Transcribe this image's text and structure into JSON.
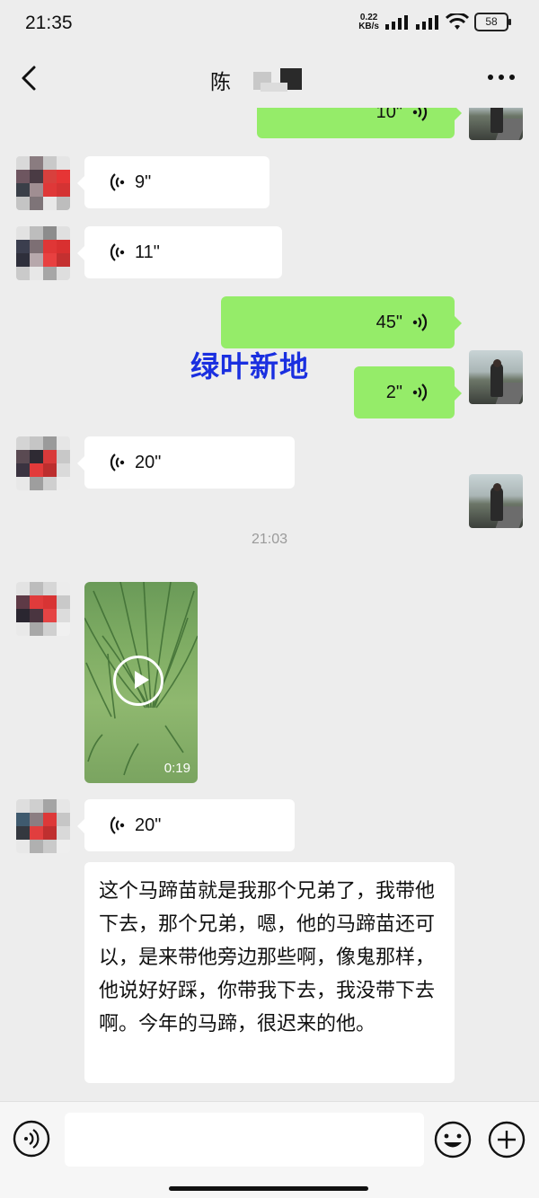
{
  "status": {
    "time": "21:35",
    "net_speed": "0.22",
    "net_unit": "KB/s",
    "battery": "58"
  },
  "nav": {
    "title": "陈",
    "back_icon": "chevron-left-icon",
    "more_icon": "more-dots-icon"
  },
  "messages": [
    {
      "side": "out",
      "type": "voice",
      "duration": "10\""
    },
    {
      "side": "in",
      "type": "voice",
      "duration": "9\""
    },
    {
      "side": "in",
      "type": "voice",
      "duration": "11\""
    },
    {
      "side": "out",
      "type": "voice",
      "duration": "45\""
    },
    {
      "side": "out",
      "type": "voice",
      "duration": "2\""
    },
    {
      "side": "in",
      "type": "voice",
      "duration": "20\""
    },
    {
      "type": "timestamp",
      "text": "21:03"
    },
    {
      "side": "in",
      "type": "video",
      "duration": "0:19"
    },
    {
      "side": "in",
      "type": "voice",
      "duration": "20\""
    },
    {
      "side": "in",
      "type": "text",
      "text": "这个马蹄苗就是我那个兄弟了，我带他下去，那个兄弟，嗯，他的马蹄苗还可以，是来带他旁边那些啊，像鬼那样，他说好好踩，你带我下去，我没带下去啊。今年的马蹄，很迟来的他。"
    }
  ],
  "watermark": "绿叶新地",
  "colors": {
    "background": "#ededed",
    "outgoing_bubble": "#95ec69",
    "incoming_bubble": "#ffffff",
    "watermark": "#1a2fe0"
  },
  "inputbar": {
    "voice_icon": "voice-input-icon",
    "emoji_icon": "emoji-icon",
    "plus_icon": "plus-icon"
  }
}
